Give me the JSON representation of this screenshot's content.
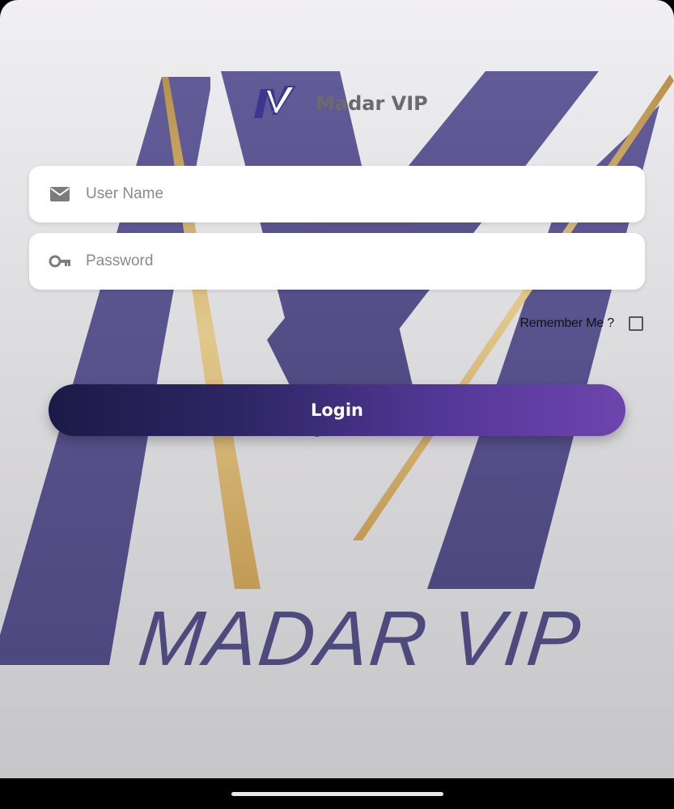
{
  "app": {
    "title": "Madar VIP",
    "brand_wordmark": "MADAR VIP"
  },
  "form": {
    "username": {
      "placeholder": "User Name",
      "value": "",
      "icon": "mail-icon"
    },
    "password": {
      "placeholder": "Password",
      "value": "",
      "icon": "key-icon"
    },
    "remember_label": "Remember Me ?",
    "remember_checked": false,
    "login_label": "Login"
  },
  "colors": {
    "brand_purple": "#5a5690",
    "gold": "#c9a85a",
    "button_start": "#1b1a47",
    "button_end": "#6d45ad"
  }
}
